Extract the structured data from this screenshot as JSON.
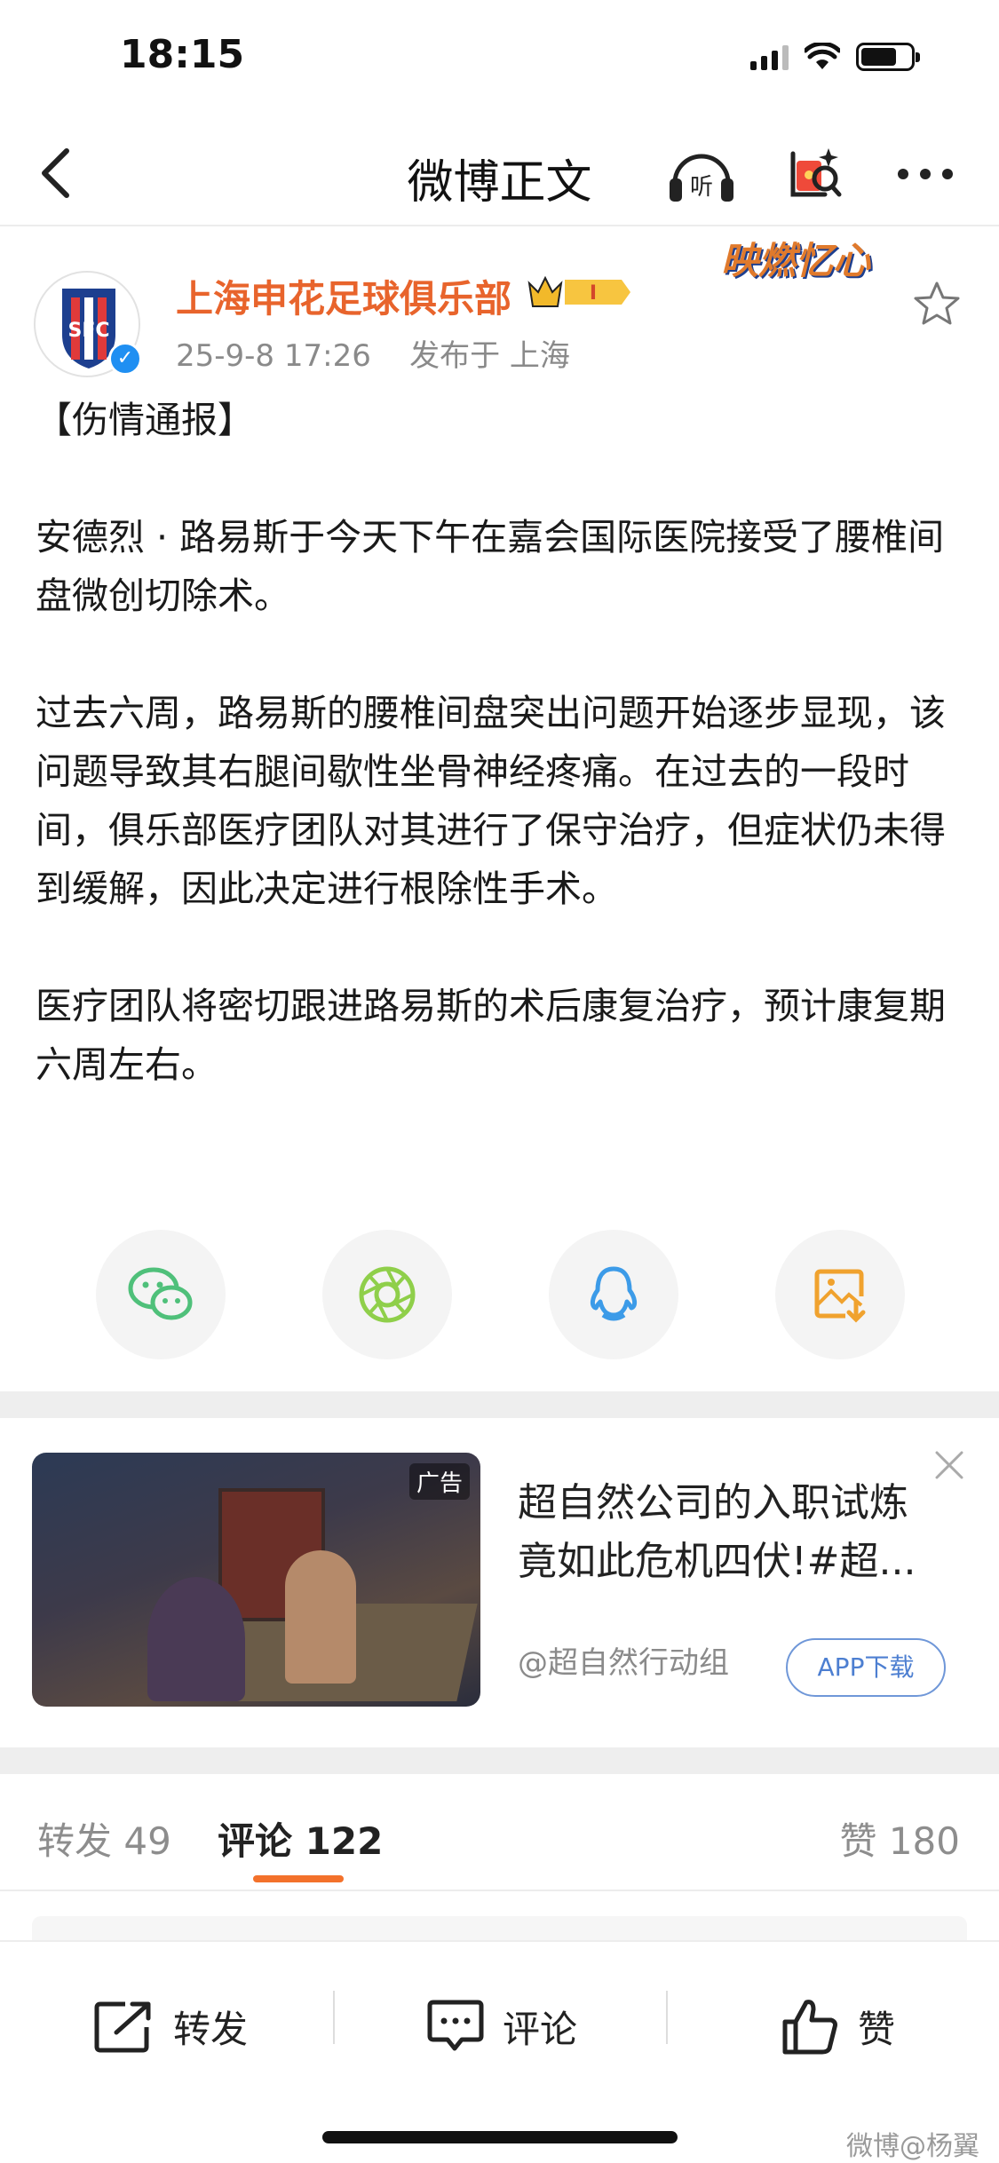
{
  "status_bar": {
    "time": "18:15"
  },
  "nav": {
    "title": "微博正文",
    "listen_icon": "headphones-listen-icon",
    "redpacket_icon": "red-packet-icon",
    "more_icon": "more-dots-icon"
  },
  "post": {
    "author": "上海申花足球俱乐部",
    "badge_level": "I",
    "timestamp": "25-9-8 17:26",
    "location": "发布于 上海",
    "decoration_text": "映燃忆心",
    "paragraphs": [
      "【伤情通报】",
      "安德烈 · 路易斯于今天下午在嘉会国际医院接受了腰椎间盘微创切除术。",
      "过去六周，路易斯的腰椎间盘突出问题开始逐步显现，该问题导致其右腿间歇性坐骨神经疼痛。在过去的一段时间，俱乐部医疗团队对其进行了保守治疗，但症状仍未得到缓解，因此决定进行根除性手术。",
      "医疗团队将密切跟进路易斯的术后康复治疗，预计康复期六周左右。"
    ]
  },
  "share": [
    {
      "name": "wechat-icon",
      "color": "#4fc07a"
    },
    {
      "name": "moments-icon",
      "color": "#8fcf4a"
    },
    {
      "name": "qq-icon",
      "color": "#3c9be8"
    },
    {
      "name": "save-image-icon",
      "color": "#f0a22e"
    }
  ],
  "ad": {
    "label": "广告",
    "title": "超自然公司的入职试炼竟如此危机四伏!#超...",
    "source": "@超自然行动组",
    "button": "APP下载"
  },
  "tabs": {
    "repost": "转发 49",
    "comment": "评论 122",
    "like": "赞 180"
  },
  "bottom_bar": {
    "repost": "转发",
    "comment": "评论",
    "like": "赞"
  },
  "watermark": "微博@杨翼"
}
